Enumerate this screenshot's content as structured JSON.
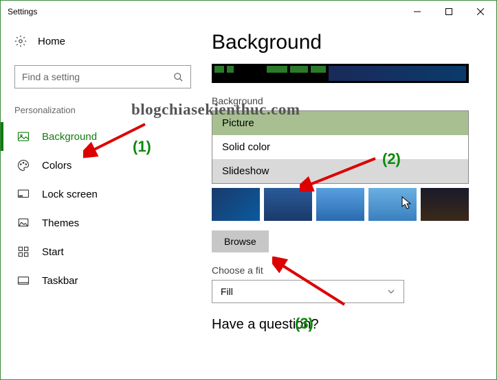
{
  "window": {
    "title": "Settings"
  },
  "sidebar": {
    "home": "Home",
    "search_placeholder": "Find a setting",
    "category": "Personalization",
    "items": [
      {
        "label": "Background"
      },
      {
        "label": "Colors"
      },
      {
        "label": "Lock screen"
      },
      {
        "label": "Themes"
      },
      {
        "label": "Start"
      },
      {
        "label": "Taskbar"
      }
    ]
  },
  "main": {
    "heading": "Background",
    "bg_label": "Background",
    "options": [
      {
        "label": "Picture"
      },
      {
        "label": "Solid color"
      },
      {
        "label": "Slideshow"
      }
    ],
    "browse": "Browse",
    "fit_label": "Choose a fit",
    "fit_value": "Fill",
    "question": "Have a question?"
  },
  "watermark": "blogchiasekienthuc.com",
  "annotations": {
    "a1": "(1)",
    "a2": "(2)",
    "a3": "(3)"
  }
}
